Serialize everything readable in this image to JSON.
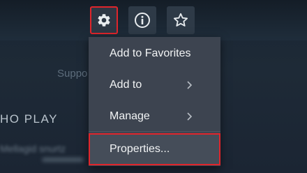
{
  "background": {
    "support_text": "Suppo",
    "section_heading": "HO PLAY",
    "blurred_text": "Mellagid snurtz"
  },
  "toolbar": {
    "settings_icon": "gear-icon",
    "info_icon": "info-icon",
    "favorite_icon": "star-icon"
  },
  "context_menu": {
    "items": [
      {
        "label": "Add to Favorites",
        "has_submenu": false
      },
      {
        "label": "Add to",
        "has_submenu": true
      },
      {
        "label": "Manage",
        "has_submenu": true
      },
      {
        "label": "Properties...",
        "has_submenu": false
      }
    ]
  },
  "colors": {
    "highlight_border": "#e0252b",
    "menu_background": "#3d4450",
    "menu_text": "#f2f4f5",
    "button_background": "#2e3a47"
  }
}
